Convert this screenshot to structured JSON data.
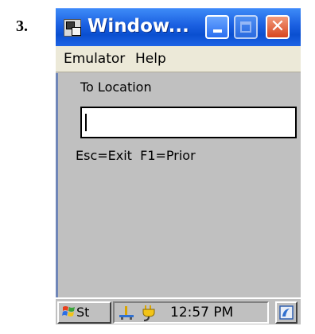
{
  "step_label": "3.",
  "window": {
    "title": "Window...",
    "buttons": [
      "minimize",
      "maximize",
      "close"
    ]
  },
  "menu": {
    "items": [
      "Emulator",
      "Help"
    ]
  },
  "form": {
    "field_label": "To Location",
    "field_value": "",
    "help_text": "Esc=Exit  F1=Prior"
  },
  "taskbar": {
    "start_label": "St",
    "clock": "12:57 PM"
  },
  "colors": {
    "titlebar": "#1a5fe0",
    "close_button": "#d8451f",
    "content_bg": "#c0c0c0"
  }
}
